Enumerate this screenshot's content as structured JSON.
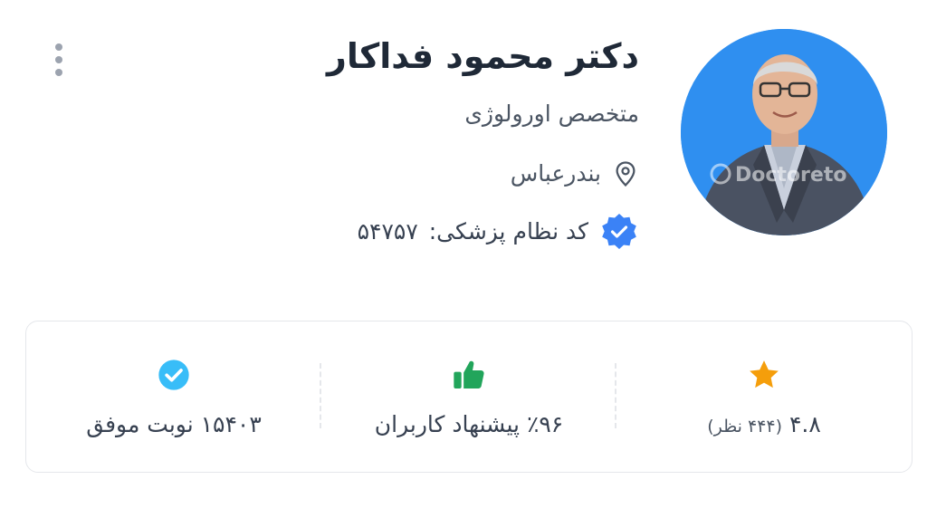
{
  "doctor": {
    "name": "دکتر محمود فداکار",
    "specialty": "متخصص اورولوژی",
    "city": "بندرعباس",
    "license_label": "کد نظام پزشکی:",
    "license_number": "۵۴۷۵۷",
    "avatar_watermark": "Doctoreto"
  },
  "icons": {
    "menu": "more-vertical-icon",
    "location": "location-pin-icon",
    "verified": "verified-badge-icon",
    "rating": "star-icon",
    "recommend": "thumbs-up-icon",
    "appointments": "check-circle-icon"
  },
  "stats": {
    "rating": {
      "value": "۴.۸",
      "reviews": "(۴۴۴ نظر)"
    },
    "recommend": {
      "text": "٪۹۶ پیشنهاد کاربران"
    },
    "appointments": {
      "text": "۱۵۴۰۳ نوبت موفق"
    }
  },
  "colors": {
    "avatar_bg": "#2f8ff0",
    "verified_blue": "#3b82f6",
    "star": "#f59e0b",
    "thumb": "#22a55b",
    "check_circle": "#38bdf8",
    "text_dark": "#1f2937",
    "text_muted": "#4b5563"
  }
}
